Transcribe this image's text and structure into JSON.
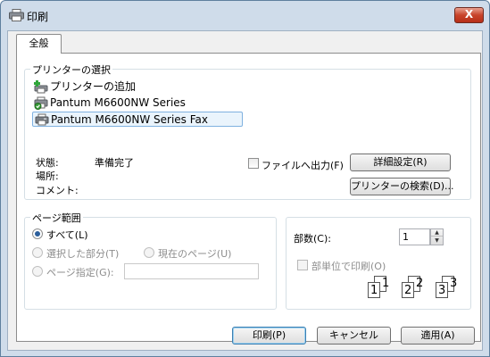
{
  "window": {
    "title": "印刷",
    "close_label": "X"
  },
  "tabs": [
    {
      "label": "全般"
    }
  ],
  "printer_group": {
    "label": "プリンターの選択",
    "printers": [
      {
        "name": "プリンターの追加",
        "icon": "add-printer-icon"
      },
      {
        "name": "Pantum M6600NW Series",
        "icon": "default-printer-icon"
      },
      {
        "name": "Pantum M6600NW Series Fax",
        "icon": "fax-printer-icon",
        "selected": true
      }
    ],
    "status_label": "状態:",
    "status_value": "準備完了",
    "location_label": "場所:",
    "comment_label": "コメント:",
    "print_to_file_label": "ファイルへ出力(F)",
    "print_to_file_checked": false,
    "preferences_button": "詳細設定(R)",
    "find_printer_button": "プリンターの検索(D)..."
  },
  "page_range_group": {
    "label": "ページ範囲",
    "all_label": "すべて(L)",
    "selection_label": "選択した部分(T)",
    "current_page_label": "現在のページ(U)",
    "pages_label": "ページ指定(G):",
    "pages_value": "",
    "selected_option": "all"
  },
  "copies_group": {
    "copies_label": "部数(C):",
    "copies_value": "1",
    "collate_label": "部単位で印刷(O)",
    "collate_checked": false,
    "collate_numbers": [
      "1",
      "1",
      "2",
      "2",
      "3",
      "3"
    ]
  },
  "footer": {
    "print_button": "印刷(P)",
    "cancel_button": "キャンセル",
    "apply_button": "適用(A)"
  }
}
